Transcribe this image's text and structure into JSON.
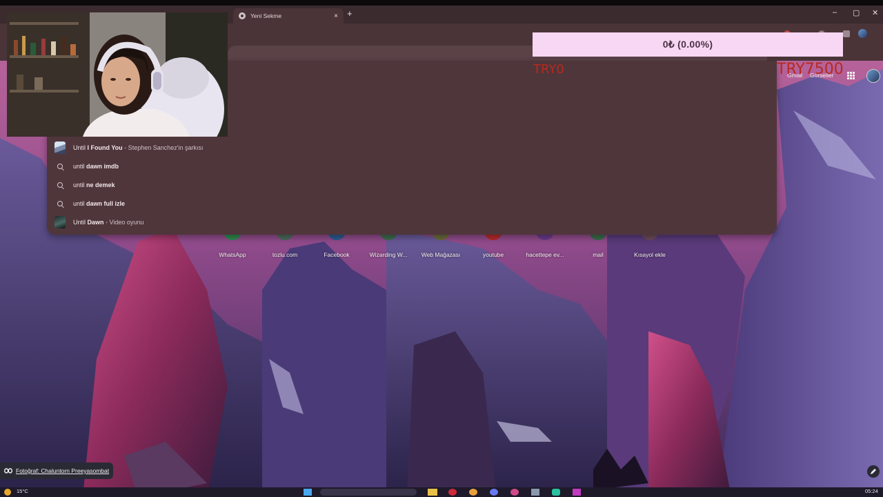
{
  "browser": {
    "active_tab_title": "Yeni Sekme",
    "new_tab_symbol": "+",
    "tab_close_symbol": "×",
    "window_controls": [
      "–",
      "▢",
      "✕"
    ]
  },
  "ntp": {
    "gmail_label": "Gmail",
    "images_label": "Görseller",
    "shortcuts": [
      {
        "label": "WhatsApp",
        "color": "#2e8a4e"
      },
      {
        "label": "tozlu.com",
        "color": "#4a6a5a"
      },
      {
        "label": "Facebook",
        "color": "#2d5a90"
      },
      {
        "label": "Wizarding W...",
        "color": "#3d6a4d"
      },
      {
        "label": "Web Mağazası",
        "color": "#6a6a3a"
      },
      {
        "label": "youtube",
        "color": "#b62a2a"
      },
      {
        "label": "hacettepe ev...",
        "color": "#6a3a8a"
      },
      {
        "label": "mail",
        "color": "#3a6a4a"
      },
      {
        "label": "Kısayol ekle",
        "color": "#6a4a5a"
      }
    ],
    "photo_credit": "Fotoğraf: Chaluntorn Preeyasombat"
  },
  "suggestions": [
    {
      "prefix": "Until ",
      "bold": "I Found You",
      "suffix": " - Stephen Sanchez'in şarkısı",
      "icon": "song-thumbnail"
    },
    {
      "prefix": "until ",
      "bold": "dawn imdb",
      "suffix": "",
      "icon": "search-icon"
    },
    {
      "prefix": "until ",
      "bold": "ne demek",
      "suffix": "",
      "icon": "search-icon"
    },
    {
      "prefix": "until ",
      "bold": "dawn full izle",
      "suffix": "",
      "icon": "search-icon"
    },
    {
      "prefix": "Until ",
      "bold": "Dawn",
      "suffix": " - Video oyunu",
      "icon": "game-thumbnail"
    }
  ],
  "overlay": {
    "price_text": "0₺ (0.00%)",
    "ghost_left": "TRY0",
    "ghost_right": "TRY7500"
  },
  "taskbar": {
    "weather": "15°C",
    "time": "05:24"
  }
}
